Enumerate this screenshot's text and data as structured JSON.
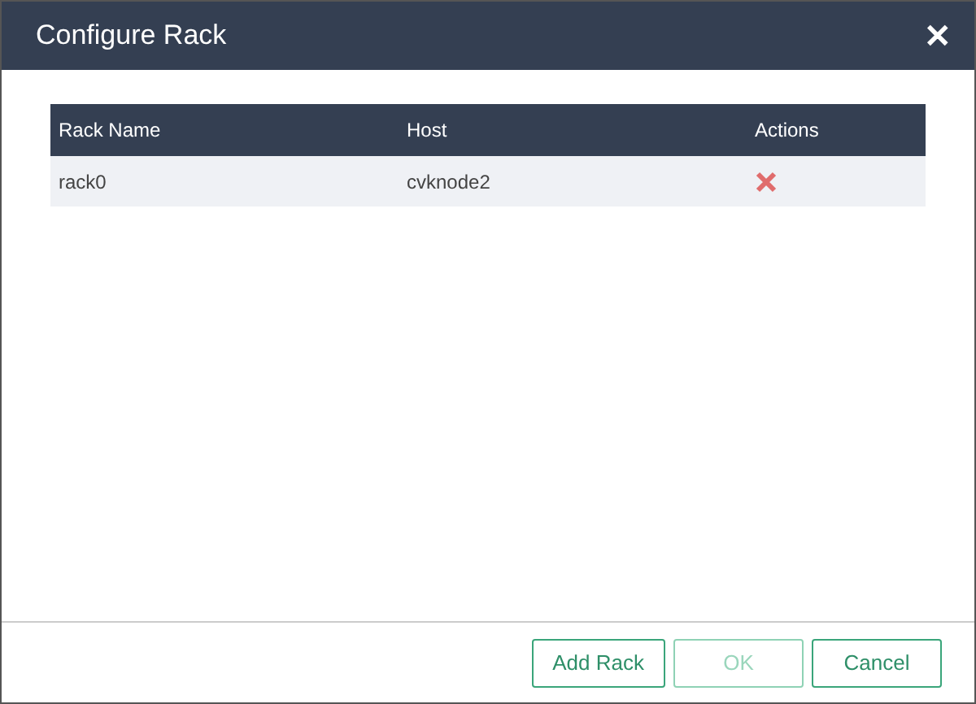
{
  "dialog": {
    "title": "Configure Rack",
    "close": "✕"
  },
  "table": {
    "columns": [
      "Rack Name",
      "Host",
      "Actions"
    ],
    "rows": [
      {
        "cells": [
          "rack0",
          "cvknode2"
        ]
      }
    ]
  },
  "buttons": [
    {
      "label": "Add Rack",
      "disabled": false
    },
    {
      "label": "OK",
      "disabled": true
    },
    {
      "label": "Cancel",
      "disabled": false
    }
  ]
}
